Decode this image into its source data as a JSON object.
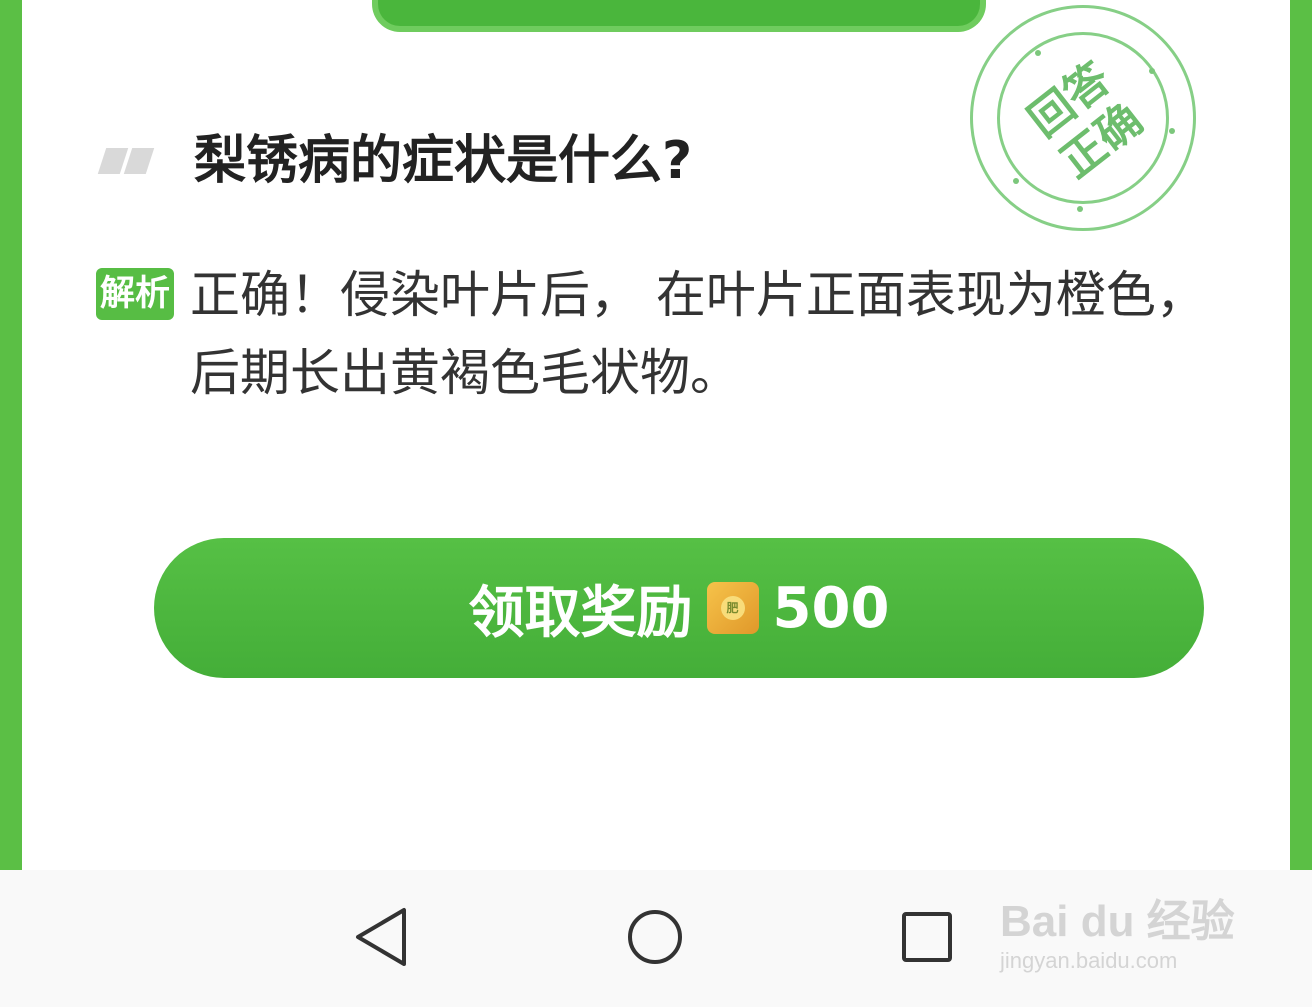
{
  "question": {
    "text": "梨锈病的症状是什么?"
  },
  "stamp": {
    "line1": "回答",
    "line2": "正确"
  },
  "analysis": {
    "badge": "解析",
    "text": "正确！侵染叶片后， 在叶片正面表现为橙色，后期长出黄褐色毛状物。"
  },
  "reward": {
    "label": "领取奖励",
    "icon": "fertilizer-bag-icon",
    "icon_text": "肥",
    "amount": "500"
  },
  "navbar": {
    "back_icon": "back-triangle-icon",
    "home_icon": "home-circle-icon",
    "recent_icon": "recent-square-icon"
  },
  "watermark": {
    "brand": "Bai du 经验",
    "url": "jingyan.baidu.com"
  },
  "colors": {
    "accent": "#5bbf45",
    "button": "#4ab63c",
    "stamp": "#6dbd6d"
  }
}
